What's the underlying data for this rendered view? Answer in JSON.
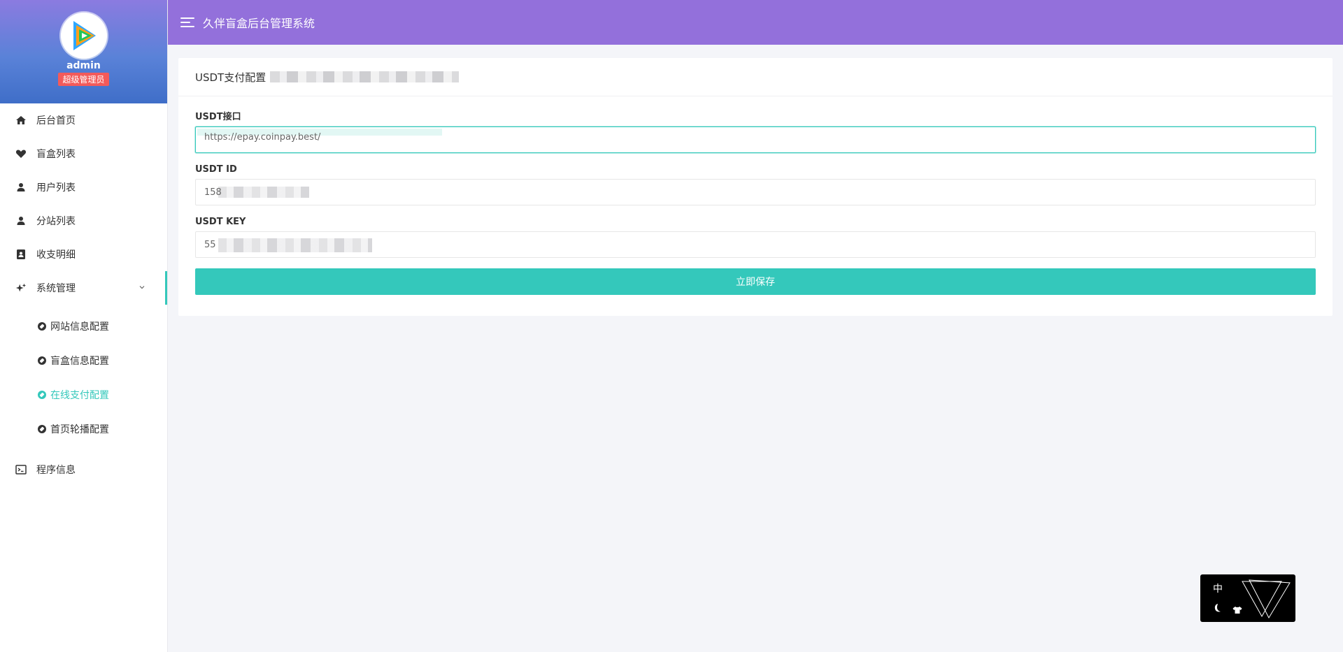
{
  "app": {
    "title": "久伴盲盒后台管理系统"
  },
  "profile": {
    "name": "admin",
    "role": "超级管理员"
  },
  "sidebar": {
    "items": [
      {
        "label": "后台首页",
        "icon": "home-icon"
      },
      {
        "label": "盲盒列表",
        "icon": "heart-icon"
      },
      {
        "label": "用户列表",
        "icon": "user-icon"
      },
      {
        "label": "分站列表",
        "icon": "user-icon"
      },
      {
        "label": "收支明细",
        "icon": "contact-book-icon"
      },
      {
        "label": "系统管理",
        "icon": "sparkle-icon",
        "expanded": true,
        "children": [
          {
            "label": "网站信息配置",
            "active": false
          },
          {
            "label": "盲盒信息配置",
            "active": false
          },
          {
            "label": "在线支付配置",
            "active": true
          },
          {
            "label": "首页轮播配置",
            "active": false
          }
        ]
      },
      {
        "label": "程序信息",
        "icon": "terminal-icon"
      }
    ]
  },
  "card": {
    "title": "USDT支付配置",
    "fields": [
      {
        "label": "USDT接口",
        "value": "https://epay.coinpay.best/",
        "focused": true
      },
      {
        "label": "USDT ID",
        "value": "158"
      },
      {
        "label": "USDT KEY",
        "value": "55"
      }
    ],
    "save_label": "立即保存"
  },
  "widget": {
    "lang_label": "中"
  },
  "colors": {
    "header_bg": "#9370db",
    "accent": "#34c8bb",
    "badge_red": "#f35a5a",
    "page_bg": "#f4f5f9"
  }
}
